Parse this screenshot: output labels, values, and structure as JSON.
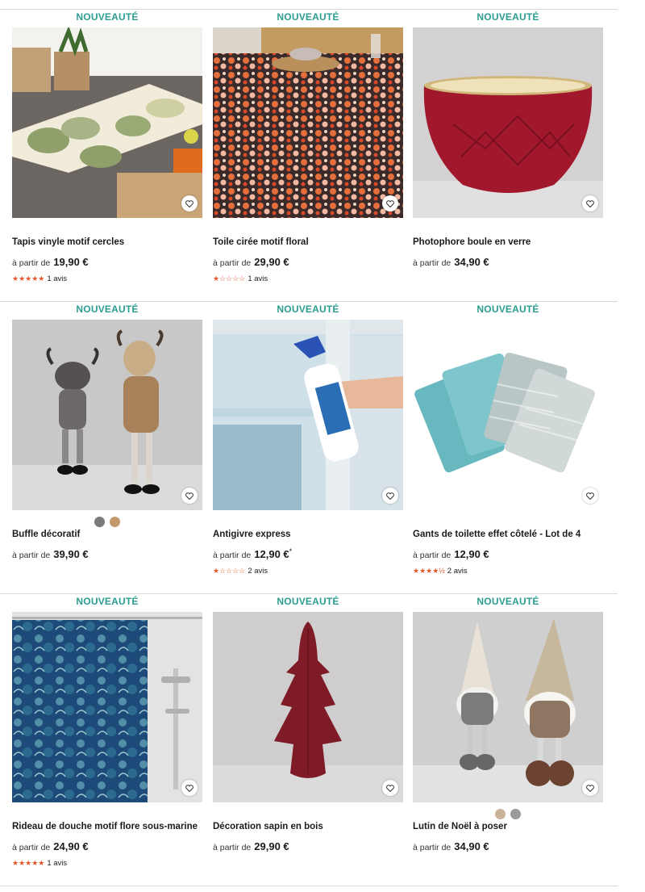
{
  "badge_label": "NOUVEAUTÉ",
  "price_prefix": "à partir de",
  "products": [
    {
      "title": "Tapis vinyle motif cercles",
      "price": "19,90 €",
      "price_note": "",
      "stars": "★★★★★",
      "reviews": "1 avis",
      "swatches": []
    },
    {
      "title": "Toile cirée motif floral",
      "price": "29,90 €",
      "price_note": "",
      "stars": "★☆☆☆☆",
      "reviews": "1 avis",
      "swatches": []
    },
    {
      "title": "Photophore boule en verre",
      "price": "34,90 €",
      "price_note": "",
      "stars": "",
      "reviews": "",
      "swatches": []
    },
    {
      "title": "Buffle décoratif",
      "price": "39,90 €",
      "price_note": "",
      "stars": "",
      "reviews": "",
      "swatches": [
        "#7b7b7b",
        "#c49a6c"
      ]
    },
    {
      "title": "Antigivre express",
      "price": "12,90 €",
      "price_note": "*",
      "stars": "★☆☆☆☆",
      "reviews": "2 avis",
      "swatches": []
    },
    {
      "title": "Gants de toilette effet côtelé - Lot de 4",
      "price": "12,90 €",
      "price_note": "",
      "stars": "★★★★½",
      "reviews": "2 avis",
      "swatches": []
    },
    {
      "title": "Rideau de douche motif flore sous-marine",
      "price": "24,90 €",
      "price_note": "",
      "stars": "★★★★★",
      "reviews": "1 avis",
      "swatches": []
    },
    {
      "title": "Décoration sapin en bois",
      "price": "29,90 €",
      "price_note": "",
      "stars": "",
      "reviews": "",
      "swatches": []
    },
    {
      "title": "Lutin de Noël à poser",
      "price": "34,90 €",
      "price_note": "",
      "stars": "",
      "reviews": "",
      "swatches": [
        "#c9b49a",
        "#9a9a9a"
      ]
    }
  ],
  "icons": {
    "favorite": "heart-outline-icon"
  },
  "colors": {
    "badge": "#2c9d92",
    "stars": "#e4572e"
  }
}
